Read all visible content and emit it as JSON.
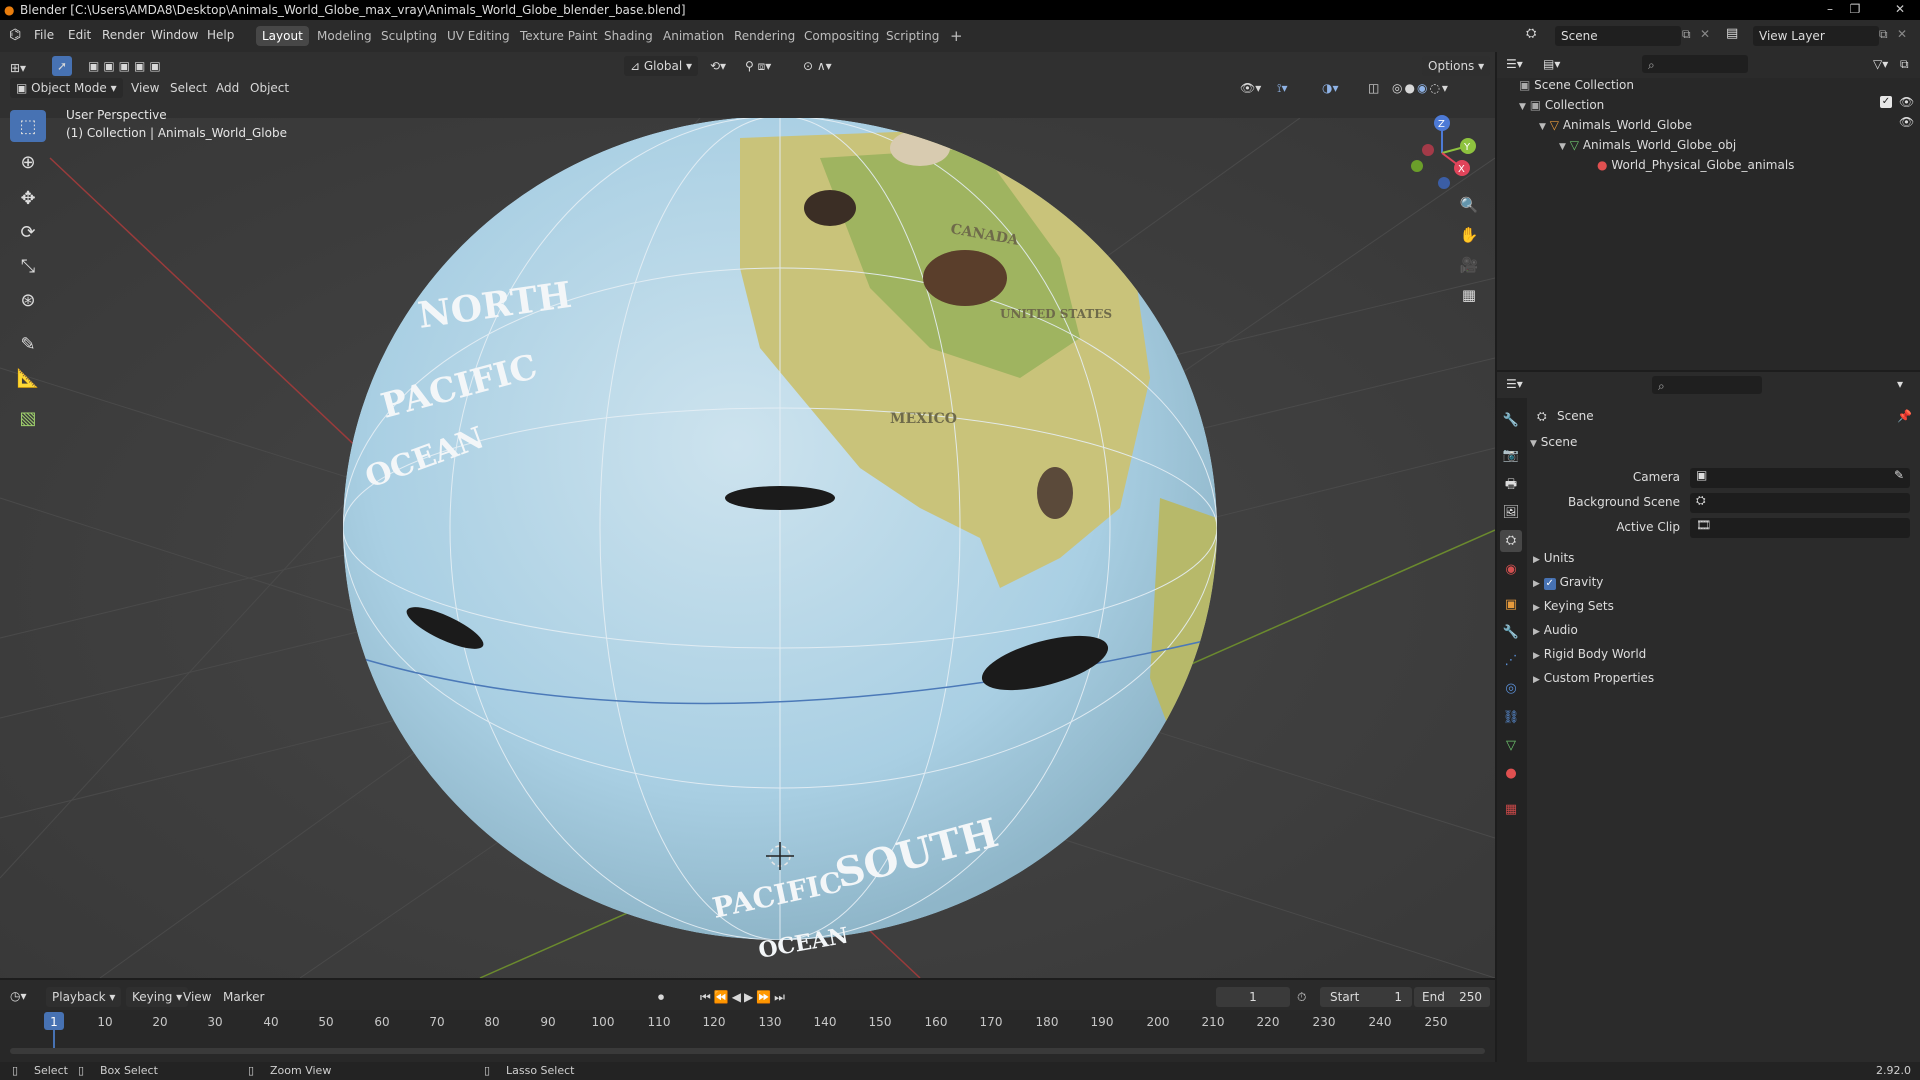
{
  "window": {
    "title": "Blender [C:\\Users\\AMDA8\\Desktop\\Animals_World_Globe_max_vray\\Animals_World_Globe_blender_base.blend]"
  },
  "menu": [
    "File",
    "Edit",
    "Render",
    "Window",
    "Help"
  ],
  "workspaces": [
    "Layout",
    "Modeling",
    "Sculpting",
    "UV Editing",
    "Texture Paint",
    "Shading",
    "Animation",
    "Rendering",
    "Compositing",
    "Scripting"
  ],
  "workspace_add": "+",
  "scene_field": "Scene",
  "view_layer_field": "View Layer",
  "viewport": {
    "transform_orientation": "Global",
    "options_label": "Options",
    "mode": "Object Mode",
    "header_menus": [
      "View",
      "Select",
      "Add",
      "Object"
    ],
    "overlay_line1": "User Perspective",
    "overlay_line2": "(1) Collection | Animals_World_Globe",
    "gizmo_axes": [
      "Z",
      "Y",
      "X"
    ],
    "globe_text": [
      "NORTH",
      "PACIFIC",
      "OCEAN",
      "CANADA",
      "UNITED STATES",
      "MEXICO",
      "SOUTH",
      "PACIFIC",
      "OCEAN"
    ]
  },
  "outliner": {
    "rows": [
      "Scene Collection",
      "Collection",
      "Animals_World_Globe",
      "Animals_World_Globe_obj",
      "World_Physical_Globe_animals"
    ]
  },
  "properties": {
    "header": "Scene",
    "panel": "Scene",
    "fields": [
      "Camera",
      "Background Scene",
      "Active Clip"
    ],
    "subpanels": [
      "Units",
      "Gravity",
      "Keying Sets",
      "Audio",
      "Rigid Body World",
      "Custom Properties"
    ],
    "gravity_checked": true
  },
  "timeline": {
    "menus": [
      "Playback",
      "Keying",
      "View",
      "Marker"
    ],
    "current_frame": "1",
    "start_label": "Start",
    "start_value": "1",
    "end_label": "End",
    "end_value": "250",
    "ticks": [
      "1",
      "10",
      "20",
      "30",
      "40",
      "50",
      "60",
      "70",
      "80",
      "90",
      "100",
      "110",
      "120",
      "130",
      "140",
      "150",
      "160",
      "170",
      "180",
      "190",
      "200",
      "210",
      "220",
      "230",
      "240",
      "250"
    ]
  },
  "statusbar": {
    "items": [
      "Select",
      "Box Select",
      "Zoom View",
      "Lasso Select"
    ],
    "version": "2.92.0"
  },
  "colors": {
    "accent": "#4772b3",
    "viewport_bg": "#3d3d3d",
    "ocean": "#a9cfe3",
    "land": "#c9c37a"
  }
}
